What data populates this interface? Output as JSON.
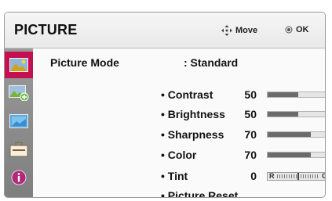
{
  "header": {
    "title": "PICTURE",
    "move_hint": "Move",
    "ok_hint": "OK",
    "move_icon": "four-way-arrows-icon",
    "ok_icon": "ok-button-icon"
  },
  "sidebar": {
    "items": [
      {
        "name": "picture-menu",
        "icon": "picture-icon",
        "active": true
      },
      {
        "name": "picture-add",
        "icon": "picture-plus-icon",
        "active": false
      },
      {
        "name": "screen",
        "icon": "screen-icon",
        "active": false
      },
      {
        "name": "option",
        "icon": "toolbox-icon",
        "active": false
      },
      {
        "name": "info",
        "icon": "info-icon",
        "active": false
      }
    ]
  },
  "picture_mode": {
    "label": "Picture Mode",
    "value": ": Standard"
  },
  "settings": [
    {
      "label": "• Contrast",
      "value": "50",
      "level": 0.5
    },
    {
      "label": "• Brightness",
      "value": "50",
      "level": 0.5
    },
    {
      "label": "• Sharpness",
      "value": "70",
      "level": 0.7
    },
    {
      "label": "• Color",
      "value": "70",
      "level": 0.7
    }
  ],
  "tint": {
    "label": "• Tint",
    "value": "0",
    "left_marker": "R",
    "right_marker": "G",
    "level": 0.5
  },
  "reset": {
    "label": "• Picture Reset"
  },
  "colors": {
    "accent": "#c4104f",
    "bar_fill": "#6b6b6b",
    "sidebar": "#8a8a8a"
  }
}
